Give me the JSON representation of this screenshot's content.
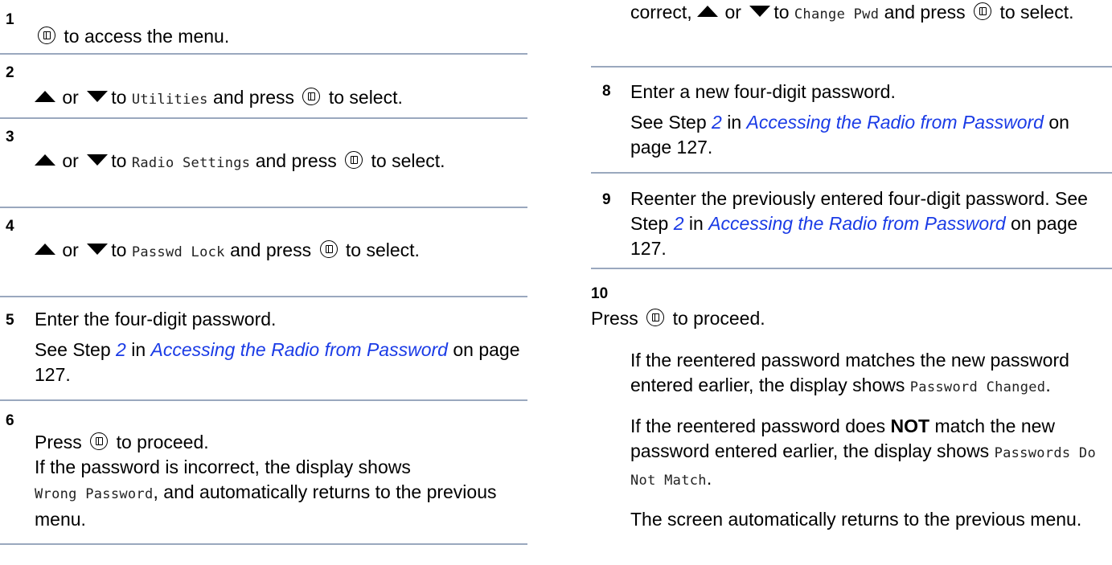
{
  "icons": {
    "ok_button": "menu-ok-button-icon",
    "up": "up-arrow-icon",
    "down": "down-arrow-icon"
  },
  "colors": {
    "link": "#1a3be6",
    "rule": "#9aa8be"
  },
  "left_steps": [
    {
      "number": "1",
      "after_icon": "to access the menu."
    },
    {
      "number": "2",
      "or": "or",
      "to": "to",
      "item": "Utilities",
      "press": "and press",
      "tail": "to select."
    },
    {
      "number": "3",
      "or": "or",
      "to": "to",
      "item": "Radio Settings",
      "press": "and press",
      "tail": "to select."
    },
    {
      "number": "4",
      "or": "or",
      "to": "to",
      "item": "Passwd Lock",
      "press": "and press",
      "tail": "to select."
    },
    {
      "number": "5",
      "line1": "Enter the four-digit password.",
      "see": "See Step",
      "step": "2",
      "in": "in",
      "link": "Accessing the Radio from Password",
      "page": "on page 127."
    },
    {
      "number": "6",
      "press": "Press",
      "tail": "to proceed.",
      "line2": "If the password is incorrect, the display shows",
      "mono": "Wrong Password",
      "line3": ", and automatically returns to the previous menu."
    }
  ],
  "right_steps": [
    {
      "lead": "correct,",
      "or": "or",
      "to": "to",
      "item": "Change Pwd",
      "press": "and press",
      "tail": "to select."
    },
    {
      "number": "8",
      "line1": "Enter a new four-digit password.",
      "see": "See Step",
      "step": "2",
      "in": "in",
      "link": "Accessing the Radio from Password",
      "page": "on page 127."
    },
    {
      "number": "9",
      "line1": "Reenter the previously entered four-digit password. See Step",
      "step": "2",
      "in": "in",
      "link": "Accessing the Radio from Password",
      "page": "on page 127."
    },
    {
      "number": "10",
      "press": "Press",
      "tail": "to proceed.",
      "p1": "If the reentered password matches the new password entered earlier, the display shows",
      "p1_mono": "Password Changed",
      "p2a": "If the reentered password does",
      "p2_bold": "NOT",
      "p2b": "match the new password entered earlier, the display shows",
      "p2_mono": "Passwords Do Not Match",
      "p3": "The screen automatically returns to the previous menu."
    }
  ]
}
